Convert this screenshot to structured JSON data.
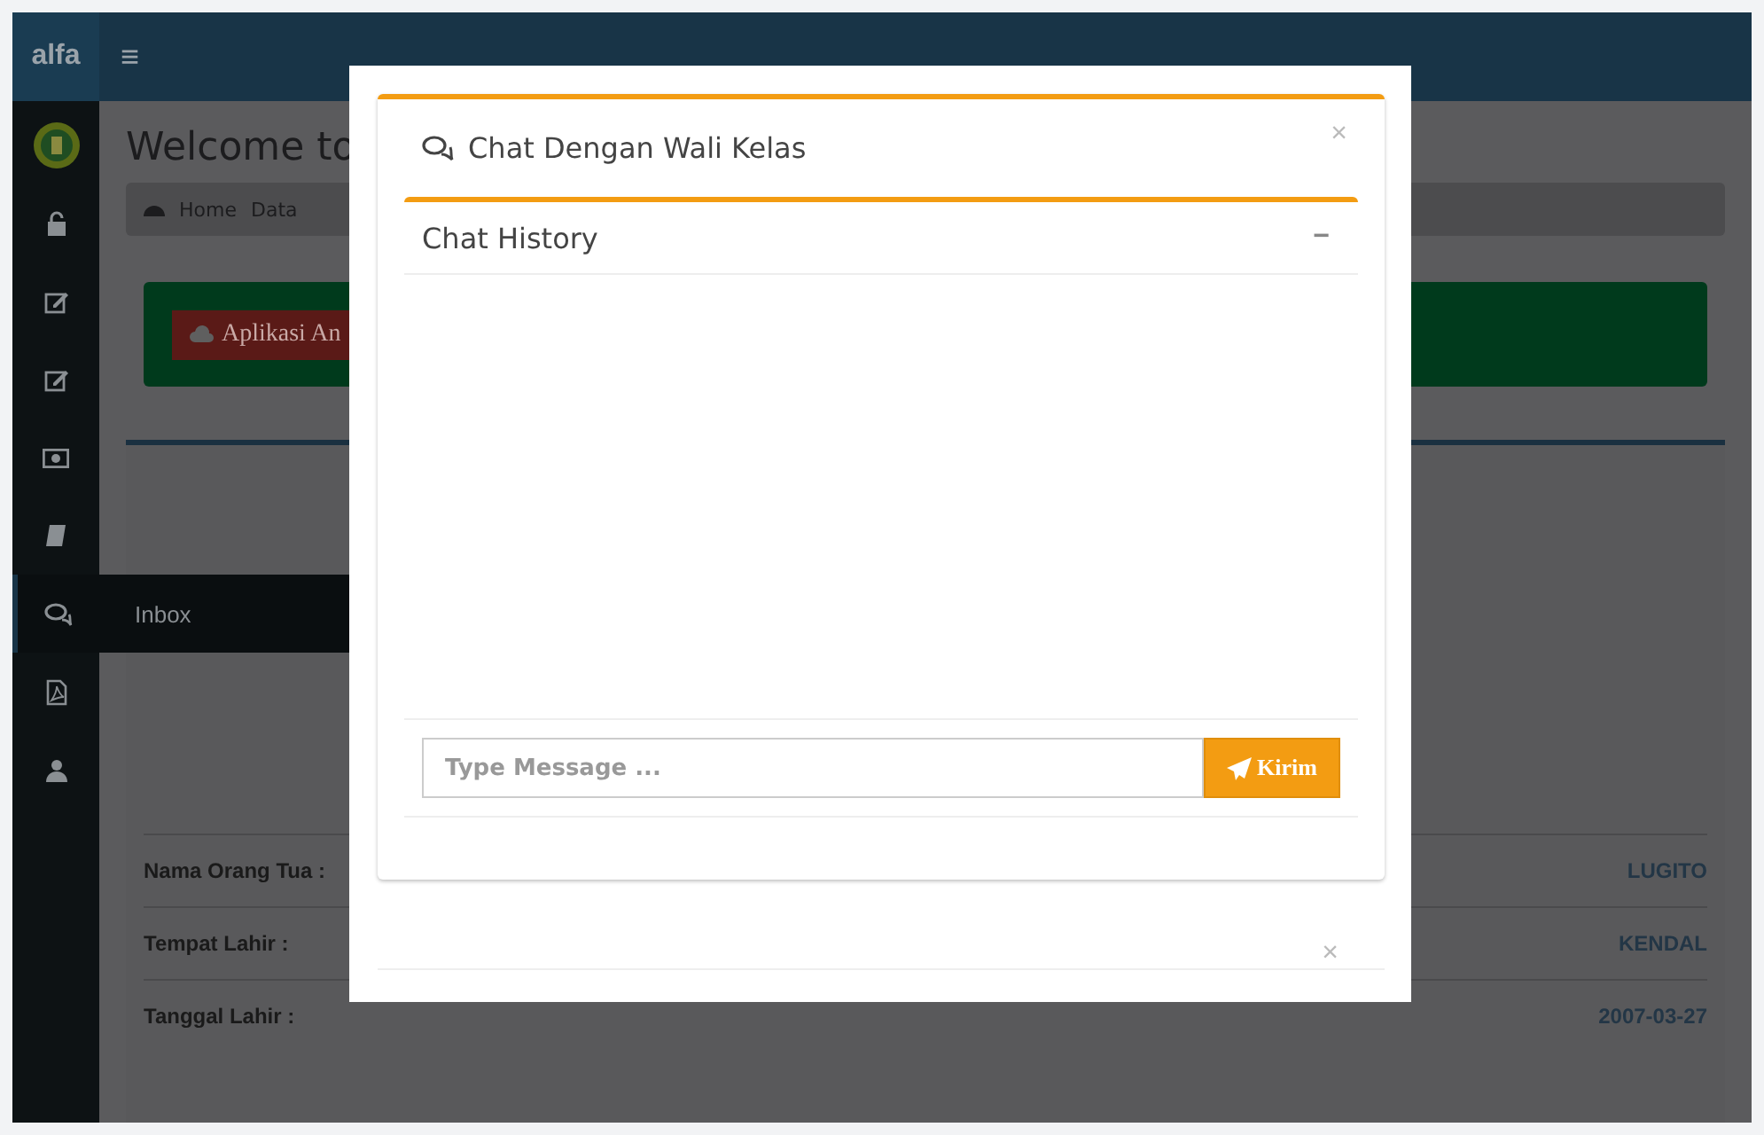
{
  "topbar": {
    "logo": "alfa",
    "menu_icon": "≡"
  },
  "sidebar": {
    "items": [
      {
        "selected": false
      },
      {
        "selected": false
      },
      {
        "selected": false
      },
      {
        "selected": false
      },
      {
        "selected": false
      },
      {
        "selected": true,
        "flyout": "Inbox"
      },
      {
        "selected": false
      },
      {
        "selected": false
      }
    ]
  },
  "page": {
    "title": "Welcome to",
    "breadcrumb": [
      "Home",
      "Data"
    ],
    "banner_button": "Aplikasi An",
    "profile": [
      {
        "label": "Nama Orang Tua :",
        "value": "LUGITO"
      },
      {
        "label": "Tempat Lahir :",
        "value": "KENDAL"
      },
      {
        "label": "Tanggal Lahir :",
        "value": "2007-03-27"
      }
    ]
  },
  "modal": {
    "title": "Chat Dengan Wali Kelas",
    "close": "×",
    "history_title": "Chat History",
    "collapse": "−",
    "message": {
      "placeholder": "Type Message ..."
    },
    "send_button": "Kirim",
    "footer_close": "×"
  }
}
